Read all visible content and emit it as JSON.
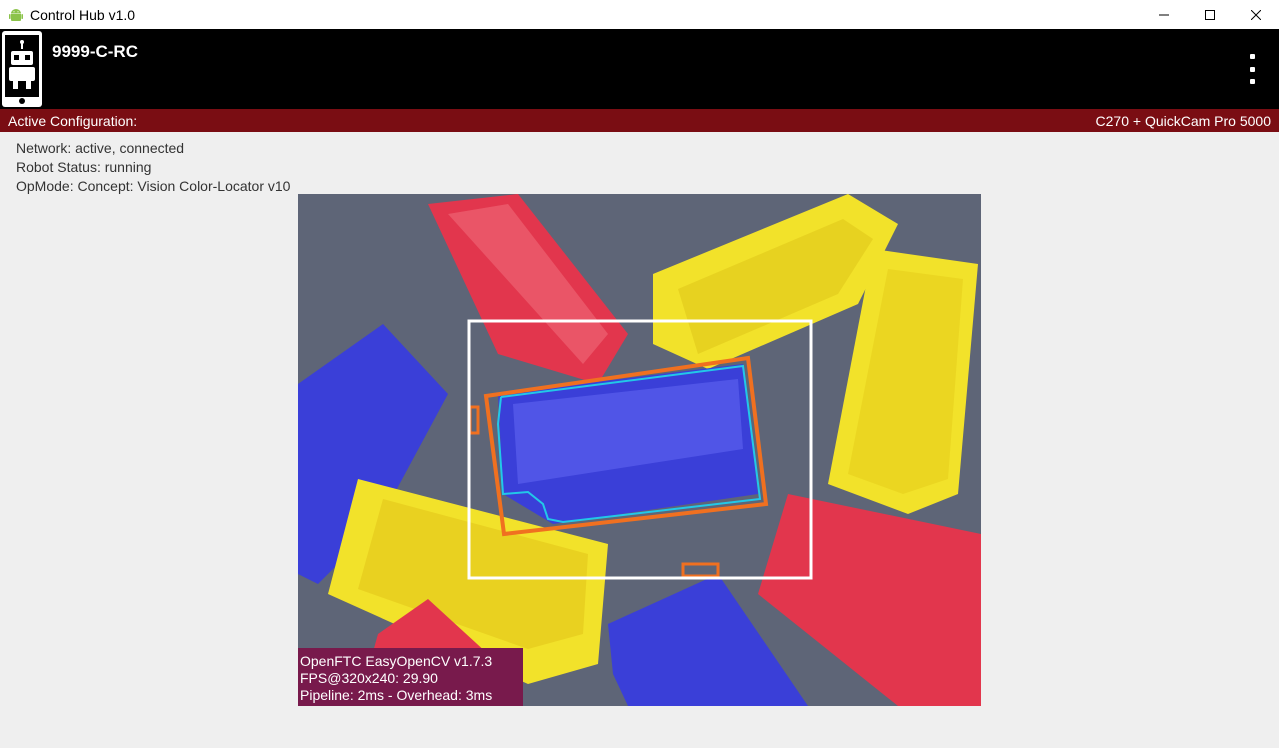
{
  "window": {
    "title": "Control Hub v1.0",
    "controls": [
      "minimize-icon",
      "maximize-icon",
      "close-icon"
    ]
  },
  "header": {
    "robot_name": "9999-C-RC",
    "logo_icon": "robot-phone-icon",
    "menu_icon": "more-vert-icon"
  },
  "config_bar": {
    "label": "Active Configuration:",
    "value": "C270 + QuickCam Pro 5000",
    "color": "#7a0d13"
  },
  "status": {
    "network": "Network: active, connected",
    "robot_status": "Robot Status: running",
    "opmode": "OpMode: Concept: Vision Color-Locator v10"
  },
  "camera": {
    "overlay": {
      "line1": "OpenFTC EasyOpenCV v1.7.3",
      "line2": "FPS@320x240: 29.90",
      "line3": "Pipeline: 2ms - Overhead: 3ms"
    },
    "colors": {
      "roi_box": "#ffffff",
      "detection_box": "#f07020",
      "contour": "#22c8e8",
      "red_block": "#e2364d",
      "yellow_block": "#f2e22a",
      "blue_block": "#3a3fd8"
    }
  }
}
